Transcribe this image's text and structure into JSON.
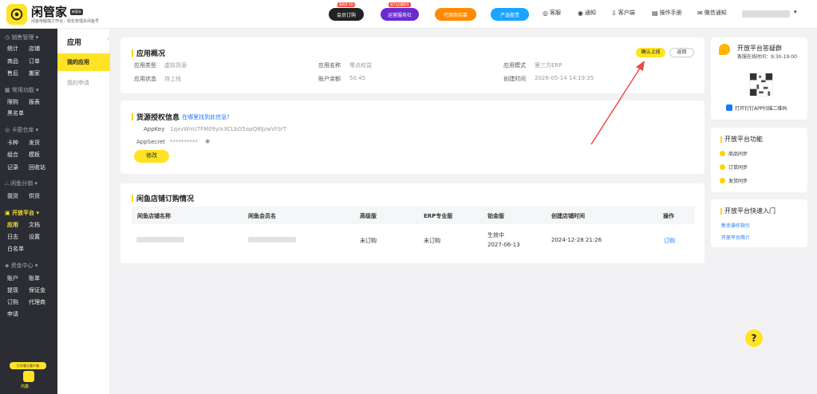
{
  "header": {
    "brand": "闲管家",
    "brand_tag": "新版本",
    "brand_sub": "闲鱼电脑端工作台，轻松管理多闲鱼号",
    "badges": [
      {
        "label": "会员订购",
        "tip": "限时8.5折",
        "color": "#222222"
      },
      {
        "label": "运营服务社",
        "tip": "助力店铺提升",
        "color": "#6a2cd0"
      },
      {
        "label": "代理商招募",
        "tip": "",
        "color": "#ff8a00"
      },
      {
        "label": "严选租赁",
        "tip": "",
        "color": "#1aa3ff"
      }
    ],
    "nav": [
      {
        "icon": "headset-icon",
        "glyph": "◎",
        "label": "客服"
      },
      {
        "icon": "bell-icon",
        "glyph": "◉",
        "label": "通知"
      },
      {
        "icon": "download-icon",
        "glyph": "⇩",
        "label": "客户端"
      },
      {
        "icon": "book-icon",
        "glyph": "▤",
        "label": "操作手册"
      },
      {
        "icon": "wechat-icon",
        "glyph": "✉",
        "label": "微信通知"
      }
    ]
  },
  "sidebar": {
    "sections": [
      {
        "label": "销售管理",
        "icon": "◷",
        "items": [
          [
            "统计",
            "店铺"
          ],
          [
            "商品",
            "订单"
          ],
          [
            "售后",
            "搬家"
          ]
        ]
      },
      {
        "label": "常用功能",
        "icon": "▦",
        "items": [
          [
            "限购",
            "报表"
          ],
          [
            "黑名单"
          ]
        ]
      },
      {
        "label": "卡密仓库",
        "icon": "◎",
        "items": [
          [
            "卡种",
            "发货"
          ],
          [
            "组合",
            "模板"
          ],
          [
            "记录",
            "回收站"
          ]
        ]
      },
      {
        "label": "闲鱼分销",
        "icon": "⛬",
        "items": [
          [
            "我货",
            "供货"
          ]
        ]
      },
      {
        "label": "开放平台",
        "icon": "▣",
        "items": [
          [
            "应用",
            "文档"
          ],
          [
            "日志",
            "设置"
          ],
          [
            "白名单"
          ]
        ]
      },
      {
        "label": "资金中心",
        "icon": "◈",
        "items": [
          [
            "账户",
            "账单"
          ],
          [
            "提现",
            "保证金"
          ],
          [
            "订购",
            "代理商"
          ],
          [
            "申请"
          ]
        ]
      }
    ],
    "promo": "打开聊天客户端",
    "gift_label": "鸿鑫"
  },
  "subnav": {
    "title": "应用",
    "items": [
      "我的应用",
      "我的申请"
    ]
  },
  "overview": {
    "title": "应用概况",
    "confirm_btn": "确认上线",
    "back_btn": "返回",
    "fields": [
      {
        "label": "应用类型",
        "value": "虚拟货源"
      },
      {
        "label": "应用名称",
        "value": "零点权益"
      },
      {
        "label": "应用模式",
        "value": "第三方ERP"
      },
      {
        "label": "应用状态",
        "value": "待上线"
      },
      {
        "label": "账户余额",
        "value": "50.45"
      },
      {
        "label": "创建时间",
        "value": "2026-05-14 14:19:35"
      }
    ]
  },
  "auth": {
    "title": "货源授权信息",
    "help_link": "在哪里找到此信息?",
    "appkey_label": "AppKey",
    "appkey_value": "1qxvWnU7FM09yIxXCLbG5apQ8lJzwVtSrT",
    "secret_label": "AppSecret",
    "secret_value": "**********",
    "edit_btn": "修改"
  },
  "subscription": {
    "title": "闲鱼店铺订购情况",
    "columns": [
      "闲鱼店铺名称",
      "闲鱼会员名",
      "高级版",
      "ERP专业版",
      "铂金版",
      "创建店铺时间",
      "操作"
    ],
    "rows": [
      {
        "advanced": "未订购",
        "erp": "未订购",
        "platinum_status": "生效中",
        "platinum_date": "2027-06-13",
        "created": "2024-12-28 21:26",
        "action": "订购"
      }
    ]
  },
  "right": {
    "group_title": "开放平台答疑群",
    "service_hours": "客服在线时间：9:30-19:00",
    "qr_hint": "打开钉钉APP扫描二维码",
    "features_title": "开放平台功能",
    "features": [
      "商品同步",
      "订单同步",
      "发货同步"
    ],
    "entry_title": "开放平台快速入门",
    "entry_links": [
      "新手操作指引",
      "开放平台简介"
    ]
  },
  "help_glyph": "?"
}
